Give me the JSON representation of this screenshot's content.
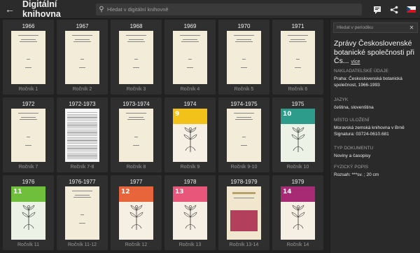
{
  "header": {
    "title": "Digitální knihovna",
    "search_placeholder": "Hledat v digitální knihovně"
  },
  "tiles": [
    {
      "year": "1966",
      "rocnik": "Ročník 1",
      "style": "plain"
    },
    {
      "year": "1967",
      "rocnik": "Ročník 2",
      "style": "plain"
    },
    {
      "year": "1968",
      "rocnik": "Ročník 3",
      "style": "plain"
    },
    {
      "year": "1969",
      "rocnik": "Ročník 4",
      "style": "plain"
    },
    {
      "year": "1970",
      "rocnik": "Ročník 5",
      "style": "plain"
    },
    {
      "year": "1971",
      "rocnik": "Ročník 6",
      "style": "plain"
    },
    {
      "year": "1972",
      "rocnik": "Ročník 7",
      "style": "plain"
    },
    {
      "year": "1972-1973",
      "rocnik": "Ročník 7-8",
      "style": "text"
    },
    {
      "year": "1973-1974",
      "rocnik": "Ročník 8",
      "style": "plain"
    },
    {
      "year": "1974",
      "rocnik": "Ročník 9",
      "style": "yellow",
      "num": "9"
    },
    {
      "year": "1974-1975",
      "rocnik": "Ročník 9-10",
      "style": "plain"
    },
    {
      "year": "1975",
      "rocnik": "Ročník 10",
      "style": "teal",
      "num": "10"
    },
    {
      "year": "1976",
      "rocnik": "Ročník 11",
      "style": "green",
      "num": "11"
    },
    {
      "year": "1976-1977",
      "rocnik": "Ročník 11-12",
      "style": "plain"
    },
    {
      "year": "1977",
      "rocnik": "Ročník 12",
      "style": "orange",
      "num": "12"
    },
    {
      "year": "1978",
      "rocnik": "Ročník 13",
      "style": "pink",
      "num": "13"
    },
    {
      "year": "1978-1979",
      "rocnik": "Ročník 13-14",
      "style": "index"
    },
    {
      "year": "1979",
      "rocnik": "Ročník 14",
      "style": "magenta",
      "num": "14"
    }
  ],
  "colors": {
    "yellow": "#f2c21b",
    "teal": "#2e9c8a",
    "green": "#6fbf3c",
    "orange": "#e8643a",
    "pink": "#e8577a",
    "magenta": "#a62a74"
  },
  "sidebar": {
    "search_placeholder": "Hledat v periodiku",
    "title": "Zprávy Československé botanické společnosti při Čs...",
    "more_label": "více",
    "sections": [
      {
        "label": "NAKLADATELSKÉ ÚDAJE",
        "values": [
          "Praha: Československá botanická společnost, 1966-1993"
        ]
      },
      {
        "label": "JAZYK",
        "values": [
          "čeština, slovenština"
        ]
      },
      {
        "label": "MÍSTO ULOŽENÍ",
        "values": [
          "Moravská zemská knihovna v Brně",
          "Signatura: 03724-0610.681"
        ]
      },
      {
        "label": "TYP DOKUMENTU",
        "values": [
          "Noviny a časopisy"
        ]
      },
      {
        "label": "FYZICKÝ POPIS",
        "values": [
          "Rozsah: ***sv. ; 20 cm"
        ]
      }
    ]
  }
}
